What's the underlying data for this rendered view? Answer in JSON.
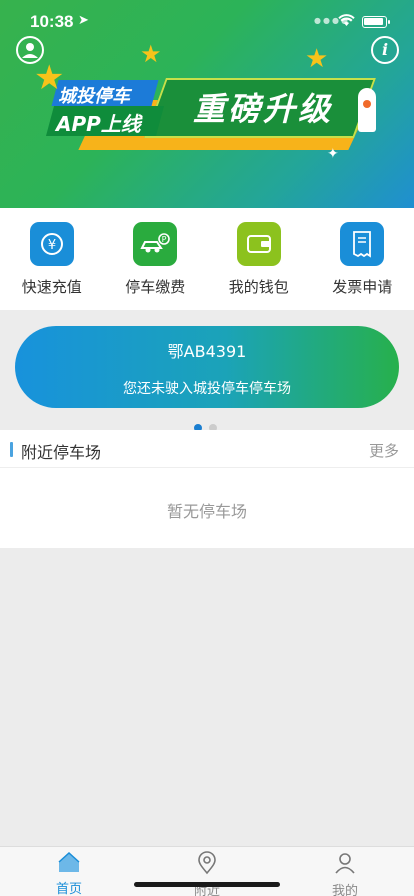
{
  "status_bar": {
    "time": "10:38"
  },
  "banner": {
    "tag_line1": "城投停车",
    "tag_line2": "APP上线",
    "headline": "重磅升级"
  },
  "quick_actions": [
    {
      "label": "快速充值",
      "icon": "yuan-refresh-icon",
      "color": "#1a8ed8"
    },
    {
      "label": "停车缴费",
      "icon": "car-parking-icon",
      "color": "#2aab3e"
    },
    {
      "label": "我的钱包",
      "icon": "wallet-icon",
      "color": "#8cc21e"
    },
    {
      "label": "发票申请",
      "icon": "invoice-tax-icon",
      "color": "#1a8ed8"
    }
  ],
  "plate_card": {
    "plate": "鄂AB4391",
    "message": "您还未驶入城投停车停车场"
  },
  "pager": {
    "active_color": "#1a7ed0",
    "inactive_color": "#cccccc"
  },
  "nearby": {
    "title": "附近停车场",
    "more": "更多",
    "empty": "暂无停车场"
  },
  "tabs": [
    {
      "label": "首页",
      "icon": "home-icon",
      "active": true
    },
    {
      "label": "附近",
      "icon": "location-pin-icon",
      "active": false
    },
    {
      "label": "我的",
      "icon": "person-icon",
      "active": false
    }
  ],
  "colors": {
    "active_tab": "#1a8ed8",
    "inactive_tab": "#8a8a8a"
  }
}
